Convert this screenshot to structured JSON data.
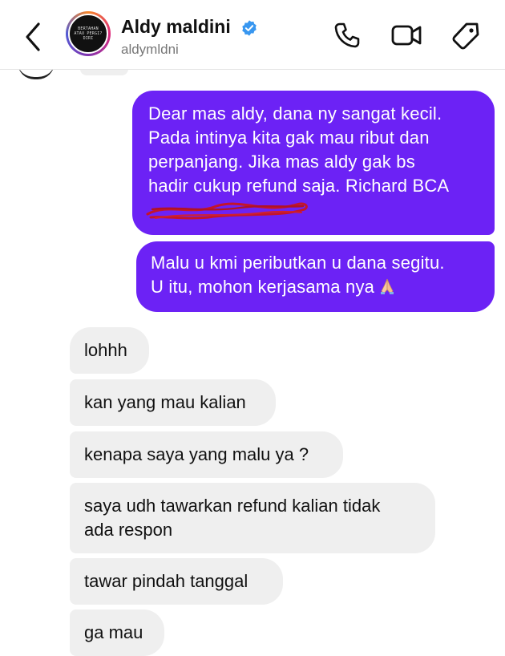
{
  "header": {
    "name": "Aldy maldini",
    "handle": "aldymldni",
    "avatar_text": "BERTAHAN ATAU PERGI? DIRI"
  },
  "icons": {
    "back": "chevron-left-icon",
    "verified": "verified-badge-icon",
    "call": "phone-icon",
    "video": "video-camera-icon",
    "tag": "tag-icon",
    "emoji": "folded-hands-emoji"
  },
  "colors": {
    "sent_bubble": "#6c22f5",
    "received_bubble": "#efefef",
    "verified": "#3897f0",
    "redaction": "#c4152a"
  },
  "messages": {
    "sent": [
      {
        "lines": [
          "Dear mas aldy, dana ny sangat kecil.",
          "Pada intinya kita gak mau ribut dan",
          "perpanjang. Jika mas aldy gak bs",
          "hadir cukup refund saja. Richard BCA"
        ],
        "redacted_line": true
      },
      {
        "lines": [
          "Malu u kmi peributkan u dana segitu.",
          "U itu, mohon kerjasama nya"
        ]
      }
    ],
    "received": [
      {
        "lines": [
          "lohhh"
        ]
      },
      {
        "lines": [
          "kan yang mau kalian"
        ]
      },
      {
        "lines": [
          "kenapa saya yang malu ya ?"
        ]
      },
      {
        "lines": [
          "saya udh tawarkan refund kalian tidak",
          "ada respon"
        ]
      },
      {
        "lines": [
          "tawar pindah tanggal"
        ]
      },
      {
        "lines": [
          "ga mau"
        ]
      }
    ]
  }
}
